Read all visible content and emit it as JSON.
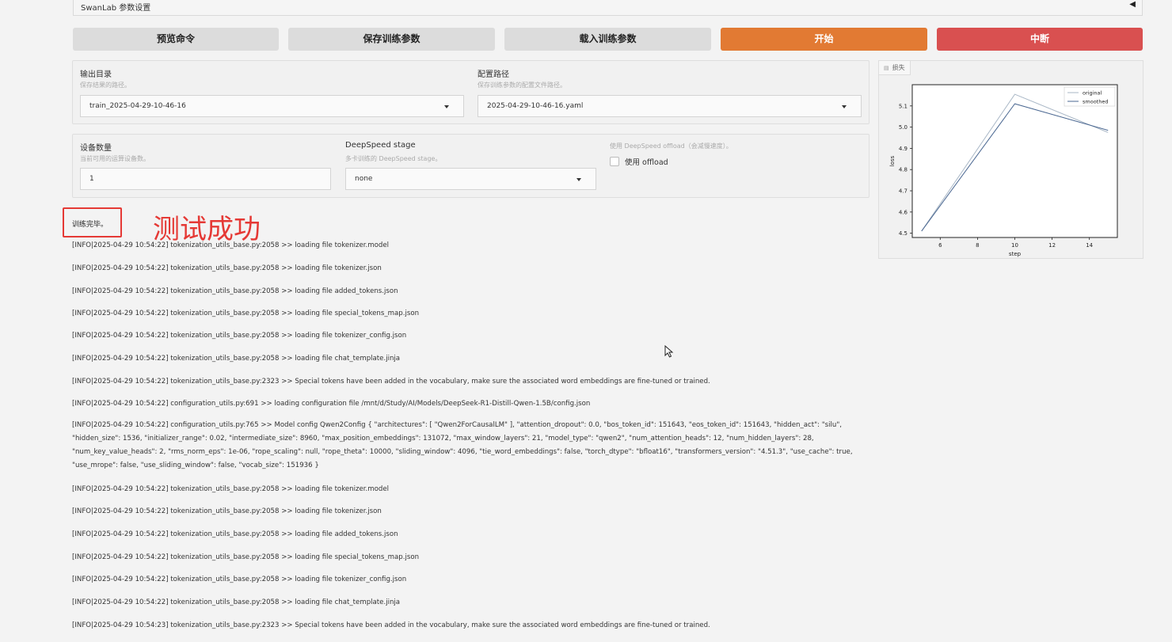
{
  "accordion": {
    "label": "SwanLab 参数设置",
    "arrow": "◀"
  },
  "buttons": {
    "preview": "预览命令",
    "save": "保存训练参数",
    "load": "载入训练参数",
    "start": "开始",
    "abort": "中断"
  },
  "output": {
    "dir_label": "输出目录",
    "dir_hint": "保存结果的路径。",
    "dir_value": "train_2025-04-29-10-46-16",
    "config_label": "配置路径",
    "config_hint": "保存训练参数的配置文件路径。",
    "config_value": "2025-04-29-10-46-16.yaml"
  },
  "device": {
    "count_label": "设备数量",
    "count_hint": "当前可用的运算设备数。",
    "count_value": "1",
    "ds_label": "DeepSpeed stage",
    "ds_hint": "多卡训练的 DeepSpeed stage。",
    "ds_value": "none",
    "offload_hint": "使用 DeepSpeed offload（会减慢速度）。",
    "offload_label": "使用 offload"
  },
  "status": {
    "done": "训练完毕。",
    "annotation": "测试成功"
  },
  "logs": [
    "[INFO|2025-04-29 10:54:22] tokenization_utils_base.py:2058 >> loading file tokenizer.model",
    "[INFO|2025-04-29 10:54:22] tokenization_utils_base.py:2058 >> loading file tokenizer.json",
    "[INFO|2025-04-29 10:54:22] tokenization_utils_base.py:2058 >> loading file added_tokens.json",
    "[INFO|2025-04-29 10:54:22] tokenization_utils_base.py:2058 >> loading file special_tokens_map.json",
    "[INFO|2025-04-29 10:54:22] tokenization_utils_base.py:2058 >> loading file tokenizer_config.json",
    "[INFO|2025-04-29 10:54:22] tokenization_utils_base.py:2058 >> loading file chat_template.jinja",
    "[INFO|2025-04-29 10:54:22] tokenization_utils_base.py:2323 >> Special tokens have been added in the vocabulary, make sure the associated word embeddings are fine-tuned or trained.",
    "[INFO|2025-04-29 10:54:22] configuration_utils.py:691 >> loading configuration file /mnt/d/Study/AI/Models/DeepSeek-R1-Distill-Qwen-1.5B/config.json",
    "[INFO|2025-04-29 10:54:22] configuration_utils.py:765 >> Model config Qwen2Config { \"architectures\": [ \"Qwen2ForCausalLM\" ], \"attention_dropout\": 0.0, \"bos_token_id\": 151643, \"eos_token_id\": 151643, \"hidden_act\": \"silu\", \"hidden_size\": 1536, \"initializer_range\": 0.02, \"intermediate_size\": 8960, \"max_position_embeddings\": 131072, \"max_window_layers\": 21, \"model_type\": \"qwen2\", \"num_attention_heads\": 12, \"num_hidden_layers\": 28, \"num_key_value_heads\": 2, \"rms_norm_eps\": 1e-06, \"rope_scaling\": null, \"rope_theta\": 10000, \"sliding_window\": 4096, \"tie_word_embeddings\": false, \"torch_dtype\": \"bfloat16\", \"transformers_version\": \"4.51.3\", \"use_cache\": true, \"use_mrope\": false, \"use_sliding_window\": false, \"vocab_size\": 151936 }",
    "[INFO|2025-04-29 10:54:22] tokenization_utils_base.py:2058 >> loading file tokenizer.model",
    "[INFO|2025-04-29 10:54:22] tokenization_utils_base.py:2058 >> loading file tokenizer.json",
    "[INFO|2025-04-29 10:54:22] tokenization_utils_base.py:2058 >> loading file added_tokens.json",
    "[INFO|2025-04-29 10:54:22] tokenization_utils_base.py:2058 >> loading file special_tokens_map.json",
    "[INFO|2025-04-29 10:54:22] tokenization_utils_base.py:2058 >> loading file tokenizer_config.json",
    "[INFO|2025-04-29 10:54:22] tokenization_utils_base.py:2058 >> loading file chat_template.jinja",
    "[INFO|2025-04-29 10:54:23] tokenization_utils_base.py:2323 >> Special tokens have been added in the vocabulary, make sure the associated word embeddings are fine-tuned or trained."
  ],
  "chart_data": {
    "type": "line",
    "tab_label": "损失",
    "xlabel": "step",
    "ylabel": "loss",
    "xlim": [
      4.5,
      15.5
    ],
    "ylim": [
      4.48,
      5.2
    ],
    "xticks": [
      6,
      8,
      10,
      12,
      14
    ],
    "yticks": [
      4.5,
      4.6,
      4.7,
      4.8,
      4.9,
      5.0,
      5.1
    ],
    "legend_position": "top-right",
    "series": [
      {
        "name": "original",
        "color": "#a9b7c6",
        "x": [
          5,
          10,
          15
        ],
        "y": [
          4.51,
          5.155,
          4.975
        ]
      },
      {
        "name": "smoothed",
        "color": "#4a6791",
        "x": [
          5,
          10,
          15
        ],
        "y": [
          4.51,
          5.11,
          4.985
        ]
      }
    ]
  }
}
